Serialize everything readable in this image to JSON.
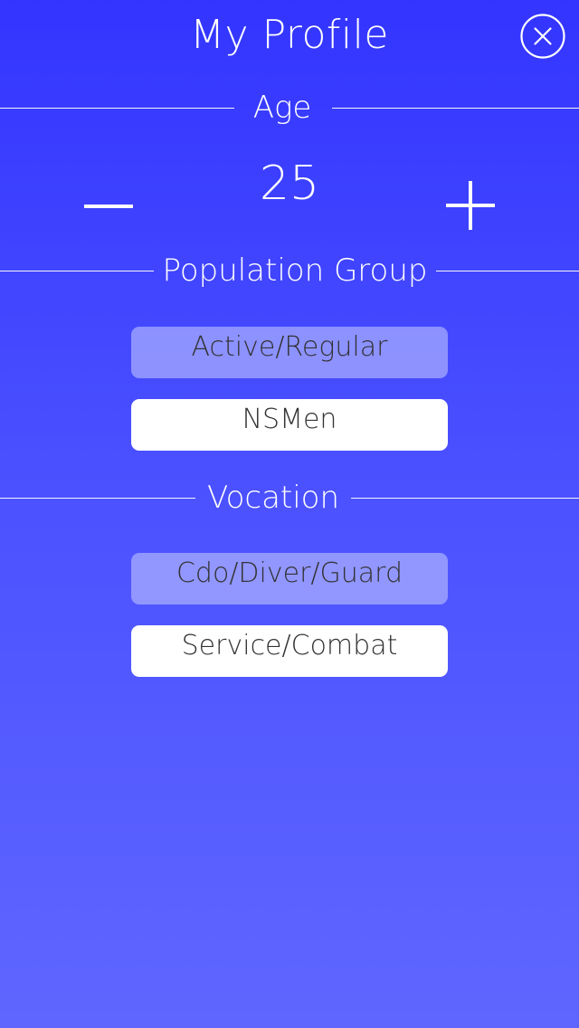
{
  "header": {
    "title": "My Profile",
    "close_icon": "close-circle-icon"
  },
  "age": {
    "label": "Age",
    "value": "25",
    "decrement_icon": "minus-icon",
    "increment_icon": "plus-icon"
  },
  "population_group": {
    "label": "Population Group",
    "options": [
      {
        "label": "Active/Regular",
        "selected": true
      },
      {
        "label": "NSMen",
        "selected": false
      }
    ]
  },
  "vocation": {
    "label": "Vocation",
    "options": [
      {
        "label": "Cdo/Diver/Guard",
        "selected": true
      },
      {
        "label": "Service/Combat",
        "selected": false
      }
    ]
  },
  "colors": {
    "background_top": "#3335ff",
    "background_bottom": "#5f66ff",
    "text_primary": "#ffffff",
    "button_text": "#333333",
    "selected_button": "#a9adff",
    "unselected_button": "#ffffff"
  }
}
